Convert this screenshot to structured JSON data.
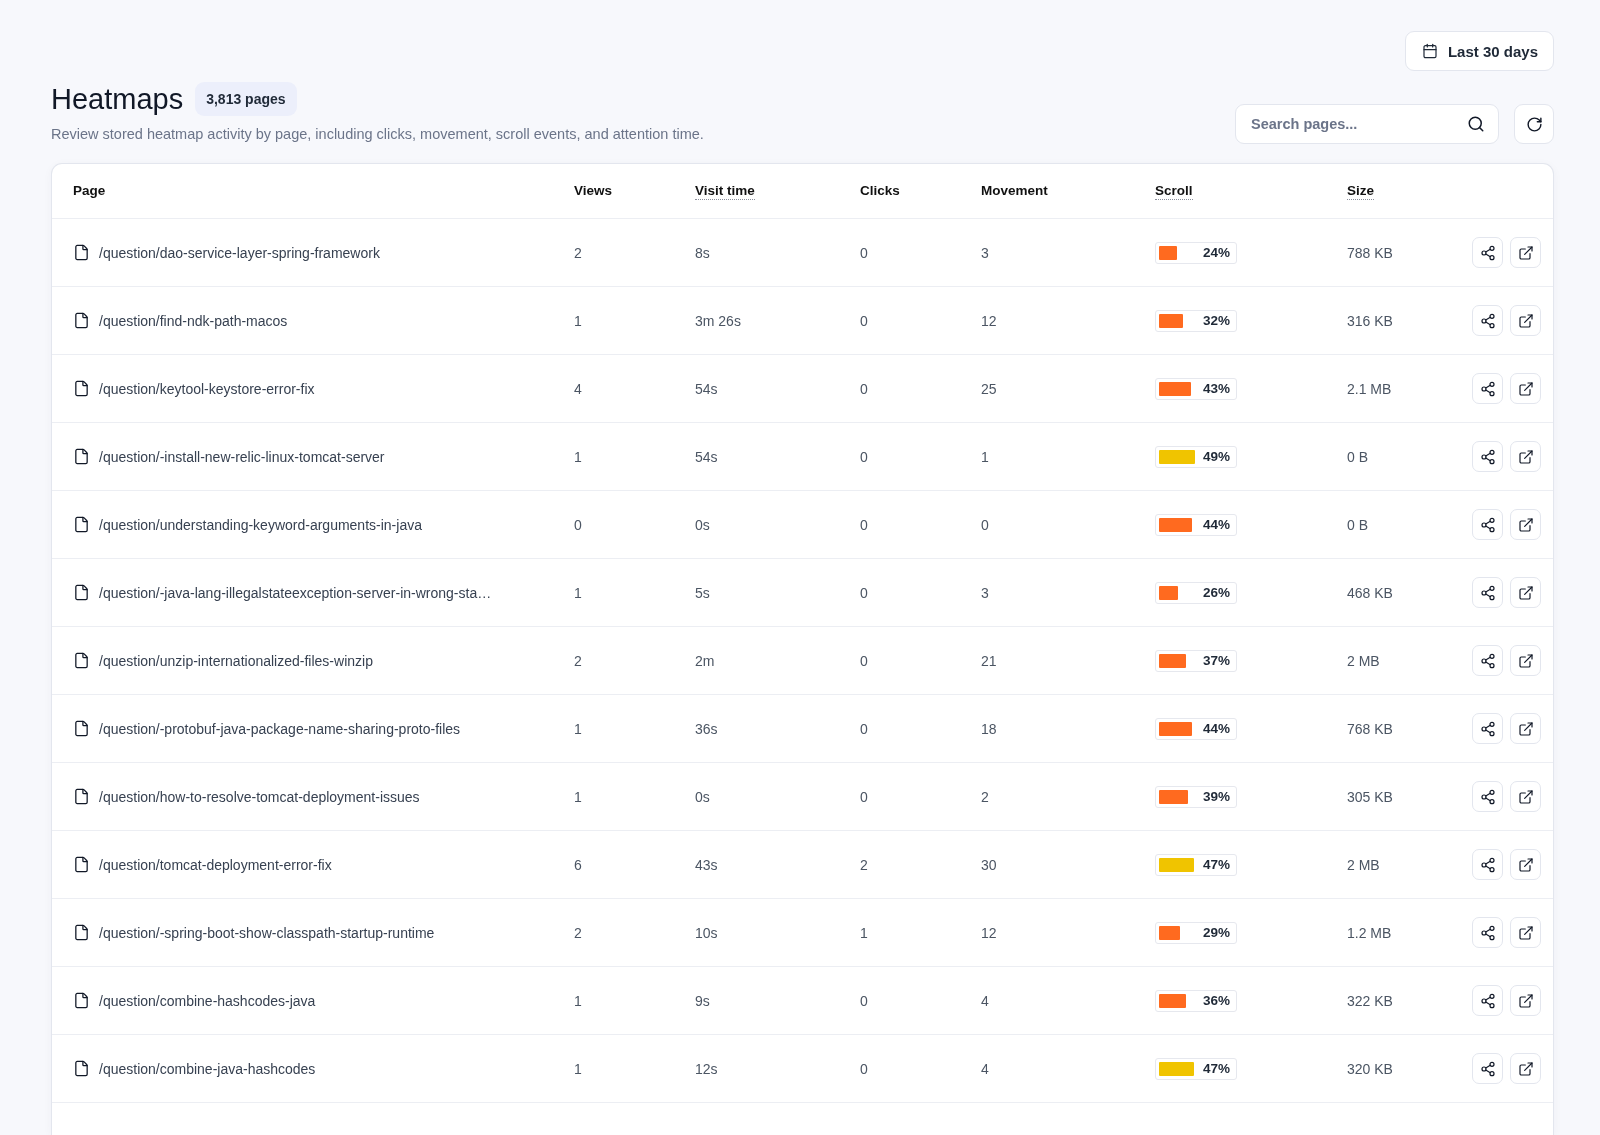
{
  "header": {
    "date_range": "Last 30 days",
    "title": "Heatmaps",
    "count_badge": "3,813 pages",
    "subtitle": "Review stored heatmap activity by page, including clicks, movement, scroll events, and attention time.",
    "search": {
      "placeholder": "Search pages..."
    }
  },
  "table": {
    "columns": [
      {
        "label": "Page",
        "underlined": false
      },
      {
        "label": "Views",
        "underlined": false
      },
      {
        "label": "Visit time",
        "underlined": true
      },
      {
        "label": "Clicks",
        "underlined": false
      },
      {
        "label": "Movement",
        "underlined": false
      },
      {
        "label": "Scroll",
        "underlined": true
      },
      {
        "label": "Size",
        "underlined": true
      }
    ],
    "rows": [
      {
        "page": "/question/dao-service-layer-spring-framework",
        "views": "2",
        "visit_time": "8s",
        "clicks": "0",
        "movement": "3",
        "scroll": {
          "level": 0.24,
          "reading": "24%",
          "color": "#ff6a1f"
        },
        "size": "788 KB"
      },
      {
        "page": "/question/find-ndk-path-macos",
        "views": "1",
        "visit_time": "3m 26s",
        "clicks": "0",
        "movement": "12",
        "scroll": {
          "level": 0.32,
          "reading": "32%",
          "color": "#ff6a1f"
        },
        "size": "316 KB"
      },
      {
        "page": "/question/keytool-keystore-error-fix",
        "views": "4",
        "visit_time": "54s",
        "clicks": "0",
        "movement": "25",
        "scroll": {
          "level": 0.43,
          "reading": "43%",
          "color": "#ff6a1f"
        },
        "size": "2.1 MB"
      },
      {
        "page": "/question/-install-new-relic-linux-tomcat-server",
        "views": "1",
        "visit_time": "54s",
        "clicks": "0",
        "movement": "1",
        "scroll": {
          "level": 0.49,
          "reading": "49%",
          "color": "#f0c400"
        },
        "size": "0 B"
      },
      {
        "page": "/question/understanding-keyword-arguments-in-java",
        "views": "0",
        "visit_time": "0s",
        "clicks": "0",
        "movement": "0",
        "scroll": {
          "level": 0.44,
          "reading": "44%",
          "color": "#ff6a1f"
        },
        "size": "0 B"
      },
      {
        "page": "/question/-java-lang-illegalstateexception-server-in-wrong-sta…",
        "views": "1",
        "visit_time": "5s",
        "clicks": "0",
        "movement": "3",
        "scroll": {
          "level": 0.26,
          "reading": "26%",
          "color": "#ff6a1f"
        },
        "size": "468 KB"
      },
      {
        "page": "/question/unzip-internationalized-files-winzip",
        "views": "2",
        "visit_time": "2m",
        "clicks": "0",
        "movement": "21",
        "scroll": {
          "level": 0.37,
          "reading": "37%",
          "color": "#ff6a1f"
        },
        "size": "2 MB"
      },
      {
        "page": "/question/-protobuf-java-package-name-sharing-proto-files",
        "views": "1",
        "visit_time": "36s",
        "clicks": "0",
        "movement": "18",
        "scroll": {
          "level": 0.44,
          "reading": "44%",
          "color": "#ff6a1f"
        },
        "size": "768 KB"
      },
      {
        "page": "/question/how-to-resolve-tomcat-deployment-issues",
        "views": "1",
        "visit_time": "0s",
        "clicks": "0",
        "movement": "2",
        "scroll": {
          "level": 0.39,
          "reading": "39%",
          "color": "#ff6a1f"
        },
        "size": "305 KB"
      },
      {
        "page": "/question/tomcat-deployment-error-fix",
        "views": "6",
        "visit_time": "43s",
        "clicks": "2",
        "movement": "30",
        "scroll": {
          "level": 0.47,
          "reading": "47%",
          "color": "#f0c400"
        },
        "size": "2 MB"
      },
      {
        "page": "/question/-spring-boot-show-classpath-startup-runtime",
        "views": "2",
        "visit_time": "10s",
        "clicks": "1",
        "movement": "12",
        "scroll": {
          "level": 0.29,
          "reading": "29%",
          "color": "#ff6a1f"
        },
        "size": "1.2 MB"
      },
      {
        "page": "/question/combine-hashcodes-java",
        "views": "1",
        "visit_time": "9s",
        "clicks": "0",
        "movement": "4",
        "scroll": {
          "level": 0.36,
          "reading": "36%",
          "color": "#ff6a1f"
        },
        "size": "322 KB"
      },
      {
        "page": "/question/combine-java-hashcodes",
        "views": "1",
        "visit_time": "12s",
        "clicks": "0",
        "movement": "4",
        "scroll": {
          "level": 0.47,
          "reading": "47%",
          "color": "#f0c400"
        },
        "size": "320 KB"
      }
    ]
  }
}
